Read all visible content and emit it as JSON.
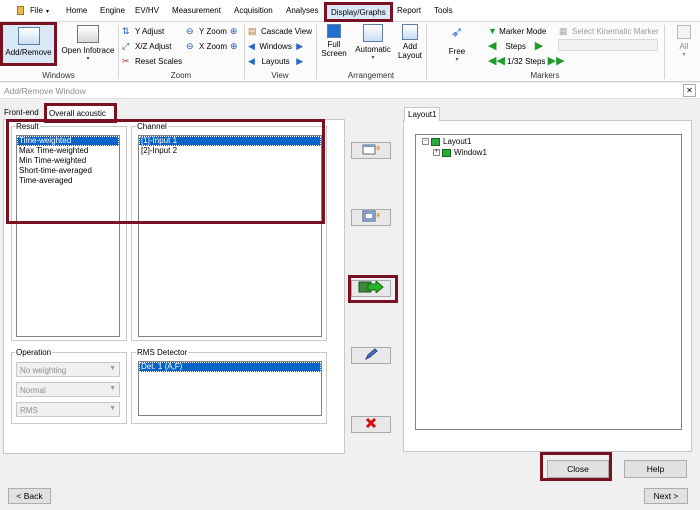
{
  "menubar": {
    "file": "File",
    "items": [
      "Home",
      "Engine",
      "EV/HV",
      "Measurement",
      "Acquisition",
      "Analyses",
      "Display/Graphs",
      "Report",
      "Tools"
    ]
  },
  "ribbon": {
    "add_remove": "Add/Remove",
    "open_infotrace": "Open Infotrace",
    "windows_group": "Windows",
    "y_adjust": "Y Adjust",
    "xz_adjust": "X/Z Adjust",
    "reset_scales": "Reset Scales",
    "y_zoom": "Y Zoom",
    "x_zoom": "X Zoom",
    "zoom_group": "Zoom",
    "cascade_view": "Cascade View",
    "windows": "Windows",
    "layouts": "Layouts",
    "view_group": "View",
    "full_screen": "Full Screen",
    "automatic": "Automatic",
    "add_layout": "Add Layout",
    "arrangement_group": "Arrangement",
    "free": "Free",
    "marker_mode": "Marker Mode",
    "steps": "Steps",
    "one_32_steps": "1/32 Steps",
    "select_kinematic_marker": "Select Kinematic Marker",
    "markers_group": "Markers",
    "all": "All"
  },
  "dialog": {
    "title": "Add/Remove Window",
    "close_glyph": "✕",
    "tabs": [
      "Front-end",
      "Overall acoustic"
    ],
    "result_label": "Result",
    "results": [
      "Time-weighted",
      "Max Time-weighted",
      "Min Time-weighted",
      "Short-time-averaged",
      "Time-averaged"
    ],
    "channel_label": "Channel",
    "channels": [
      "[1]-Input 1",
      "[2]-Input 2"
    ],
    "operation_label": "Operation",
    "operation_combos": [
      "No weighting",
      "Normal",
      "RMS"
    ],
    "rms_label": "RMS Detector",
    "rms_items": [
      "Det. 1 (A,F)"
    ],
    "layout_tab": "Layout1",
    "tree": {
      "root": "Layout1",
      "child": "Window1"
    },
    "close_button": "Close",
    "help_button": "Help",
    "back_button": "< Back",
    "next_button": "Next >"
  }
}
